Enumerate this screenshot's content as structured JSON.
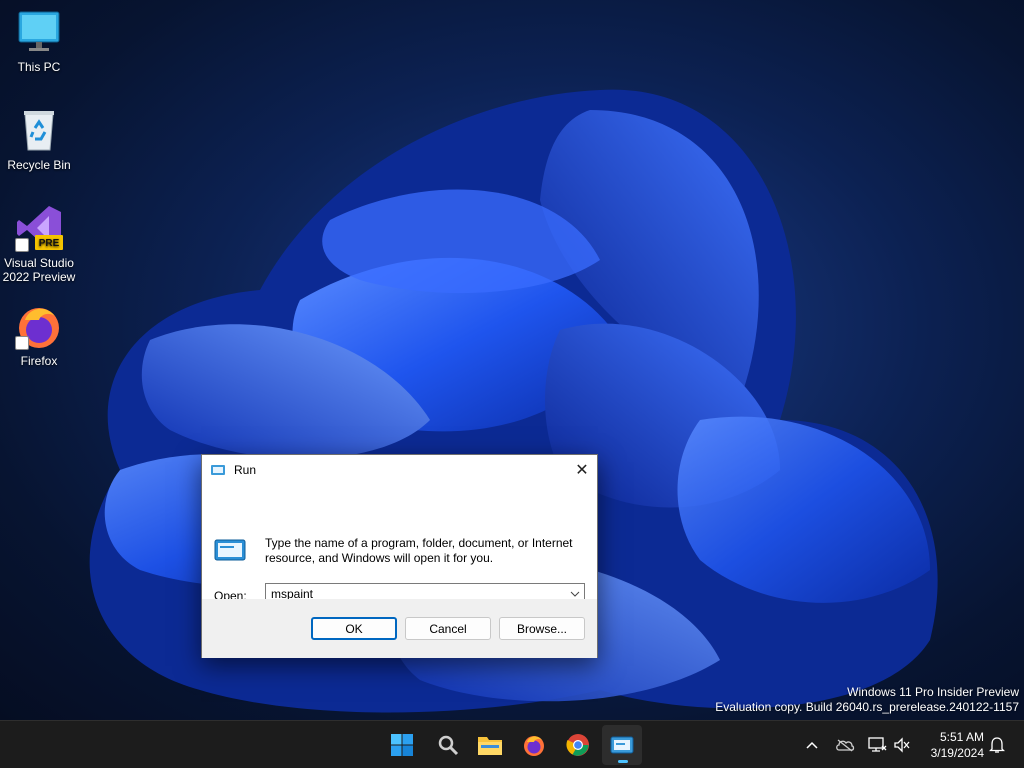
{
  "desktop": {
    "icons": [
      {
        "label": "This PC"
      },
      {
        "label": "Recycle Bin"
      },
      {
        "label": "Visual Studio 2022 Preview",
        "badge": "PRE"
      },
      {
        "label": "Firefox"
      }
    ]
  },
  "run_dialog": {
    "title": "Run",
    "close_label": "✕",
    "description": "Type the name of a program, folder, document, or Internet resource, and Windows will open it for you.",
    "open_label": "Open:",
    "open_value": "mspaint",
    "ok_label": "OK",
    "cancel_label": "Cancel",
    "browse_label": "Browse..."
  },
  "watermark": {
    "line1": "Windows 11 Pro Insider Preview",
    "line2": "Evaluation copy. Build 26040.rs_prerelease.240122-1157"
  },
  "taskbar": {
    "apps": [
      "start-icon",
      "search-icon",
      "file-explorer-icon",
      "firefox-icon",
      "chrome-icon",
      "run-icon"
    ],
    "tray": [
      "chevron-up-icon",
      "onedrive-icon",
      "network-icon",
      "volume-muted-icon",
      "notification-bell-icon"
    ],
    "clock": {
      "time": "5:51 AM",
      "date": "3/19/2024"
    }
  },
  "colors": {
    "accent": "#0067c0",
    "taskbar": "#1c1c1c",
    "wallpaper_bloom": "#1a4fe0"
  }
}
